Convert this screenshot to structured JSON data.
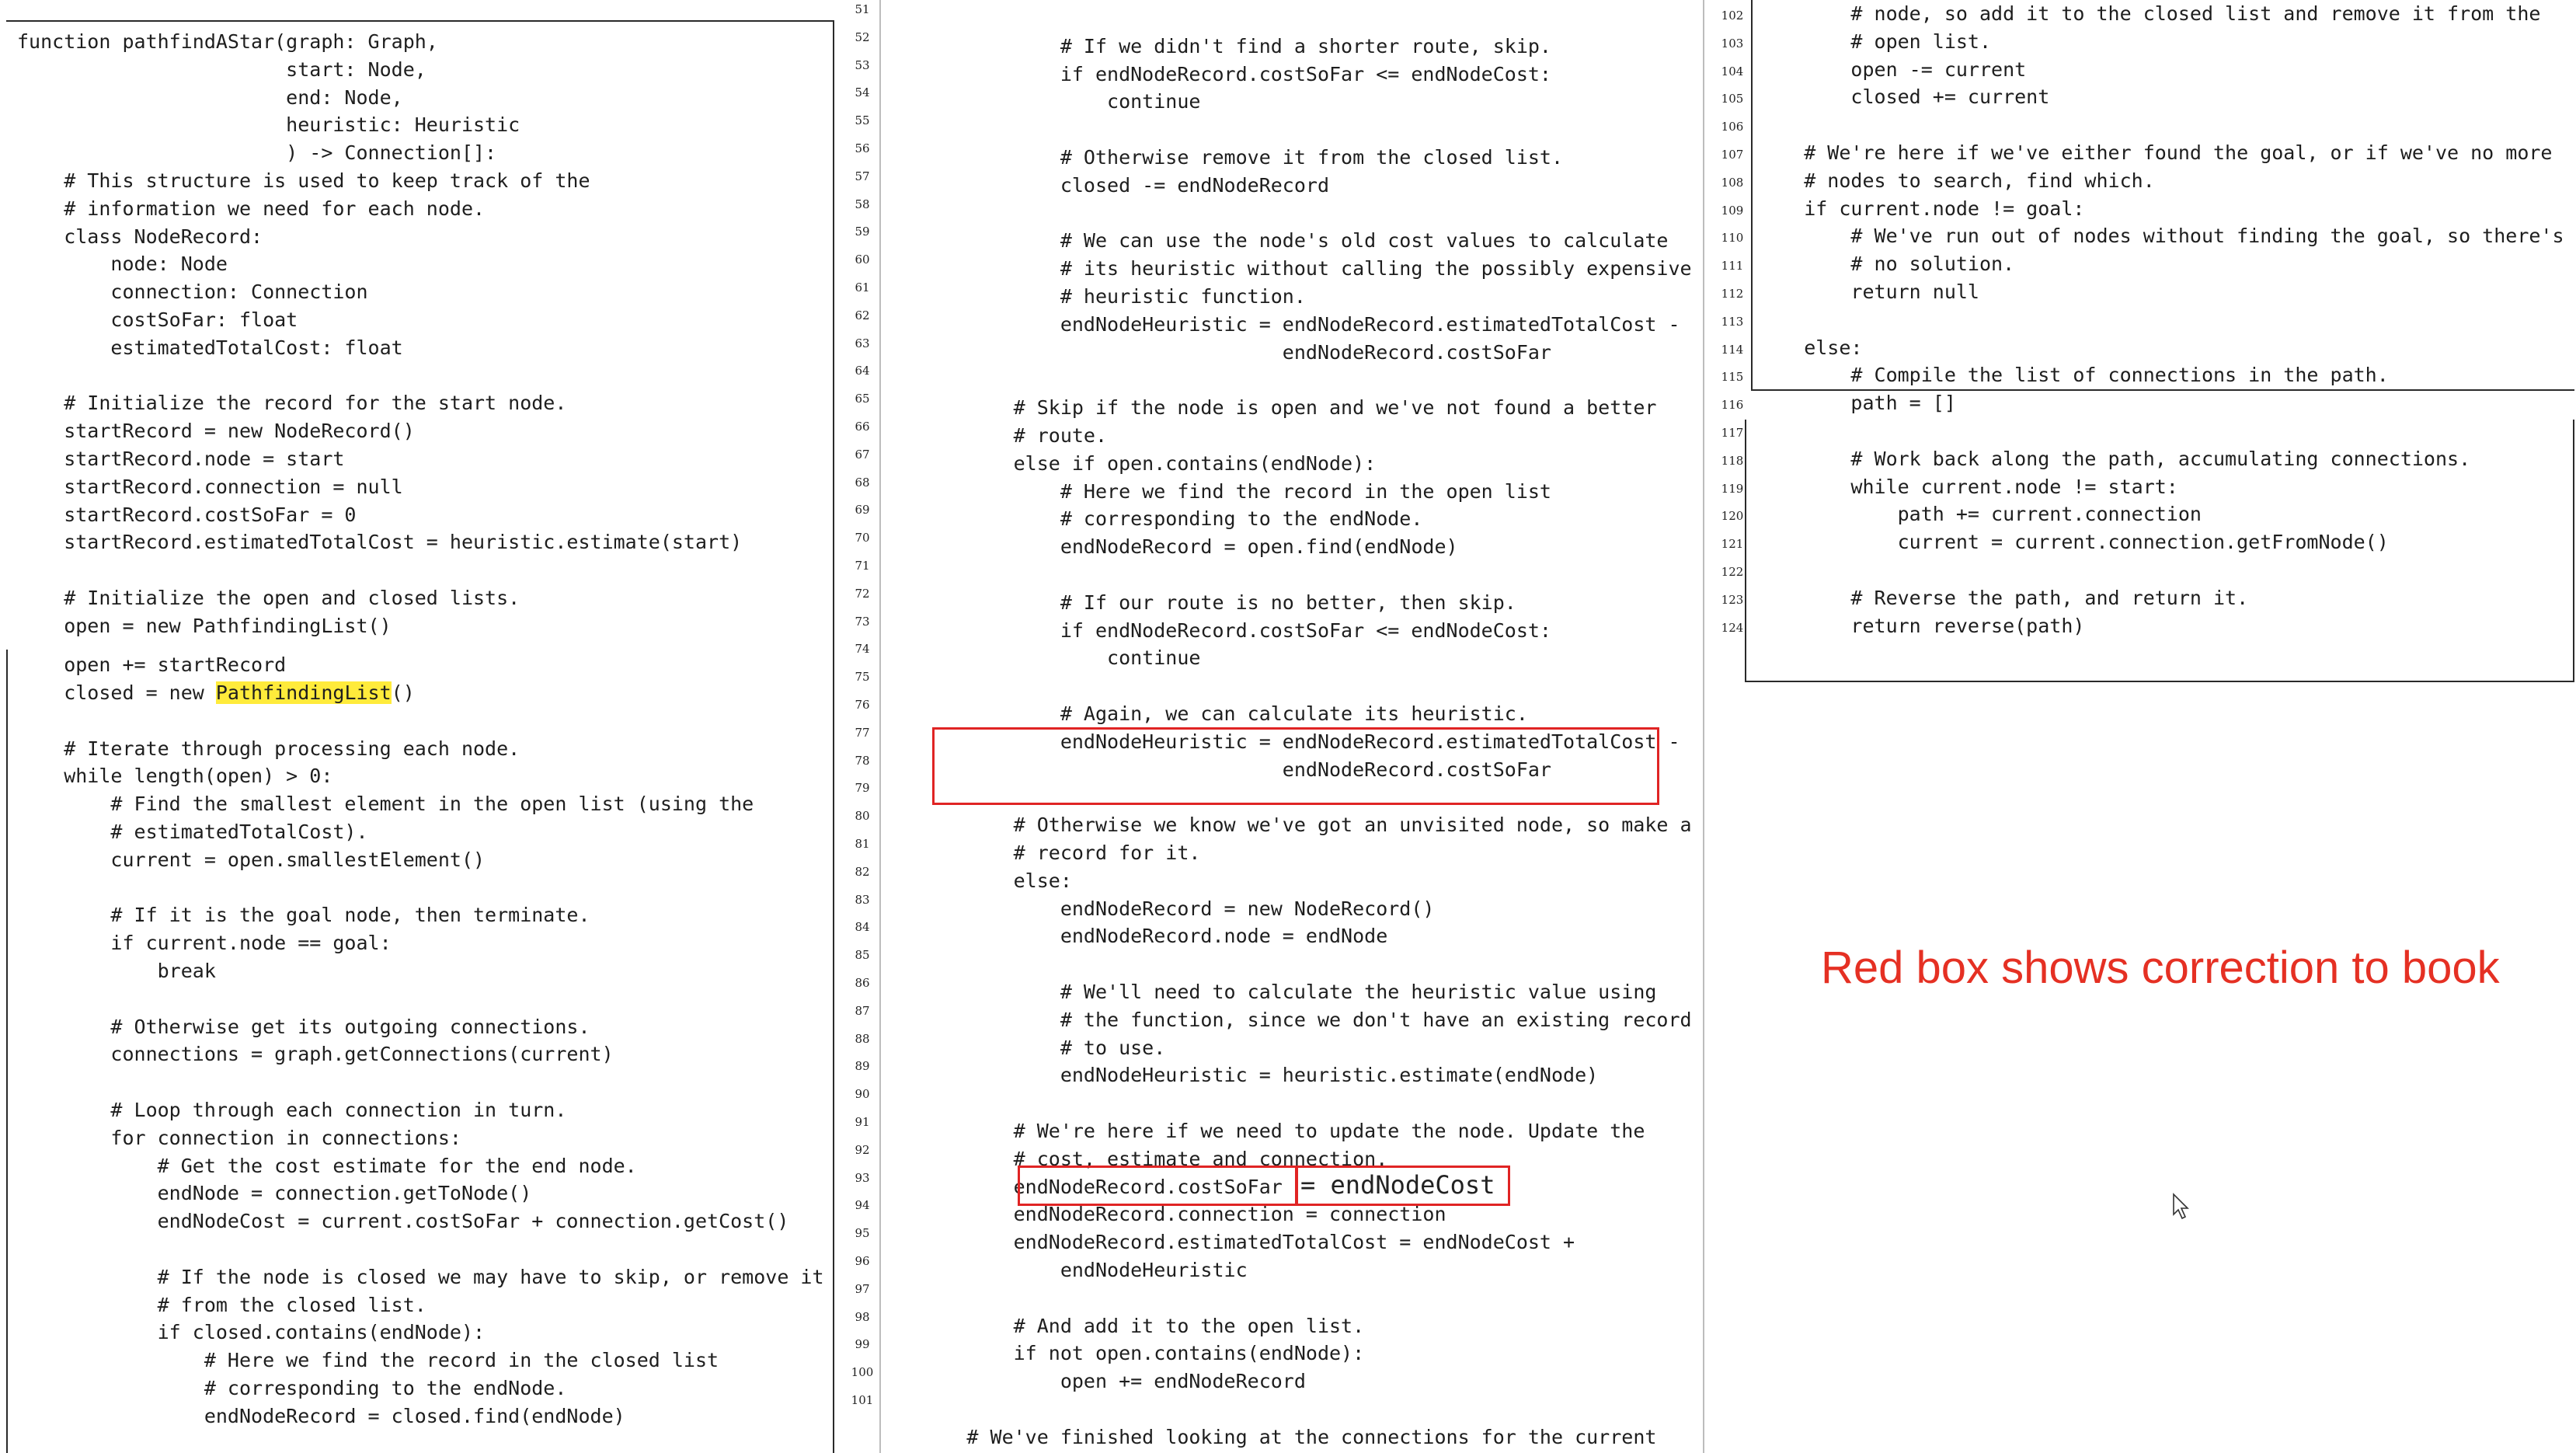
{
  "left": {
    "lines": [
      "function pathfindAStar(graph: Graph,",
      "                       start: Node,",
      "                       end: Node,",
      "                       heuristic: Heuristic",
      "                       ) -> Connection[]:",
      "    # This structure is used to keep track of the",
      "    # information we need for each node.",
      "    class NodeRecord:",
      "        node: Node",
      "        connection: Connection",
      "        costSoFar: float",
      "        estimatedTotalCost: float",
      "",
      "    # Initialize the record for the start node.",
      "    startRecord = new NodeRecord()",
      "    startRecord.node = start",
      "    startRecord.connection = null",
      "    startRecord.costSoFar = 0",
      "    startRecord.estimatedTotalCost = heuristic.estimate(start)",
      "",
      "    # Initialize the open and closed lists.",
      "    open = new PathfindingList()"
    ],
    "lines2_pre": "    closed = new ",
    "lines2_hl": "PathfindingList",
    "lines2_post": "()",
    "line_open": "    open += startRecord",
    "lines3": [
      "",
      "    # Iterate through processing each node.",
      "    while length(open) > 0:",
      "        # Find the smallest element in the open list (using the",
      "        # estimatedTotalCost).",
      "        current = open.smallestElement()",
      "",
      "        # If it is the goal node, then terminate.",
      "        if current.node == goal:",
      "            break",
      "",
      "        # Otherwise get its outgoing connections.",
      "        connections = graph.getConnections(current)",
      "",
      "        # Loop through each connection in turn.",
      "        for connection in connections:",
      "            # Get the cost estimate for the end node.",
      "            endNode = connection.getToNode()",
      "            endNodeCost = current.costSoFar + connection.getCost()",
      "",
      "            # If the node is closed we may have to skip, or remove it",
      "            # from the closed list.",
      "            if closed.contains(endNode):",
      "                # Here we find the record in the closed list",
      "                # corresponding to the endNode.",
      "                endNodeRecord = closed.find(endNode)"
    ]
  },
  "middle": {
    "numbers": [
      "51",
      "52",
      "53",
      "54",
      "55",
      "56",
      "57",
      "58",
      "59",
      "60",
      "61",
      "62",
      "63",
      "64",
      "65",
      "66",
      "67",
      "68",
      "69",
      "70",
      "71",
      "72",
      "73",
      "74",
      "75",
      "76",
      "77",
      "78",
      "79",
      "80",
      "81",
      "82",
      "83",
      "84",
      "85",
      "86",
      "87",
      "88",
      "89",
      "90",
      "91",
      "92",
      "93",
      "94",
      "95",
      "96",
      "97",
      "98",
      "99",
      "100",
      "101"
    ],
    "lines": [
      "",
      "                # If we didn't find a shorter route, skip.",
      "                if endNodeRecord.costSoFar <= endNodeCost:",
      "                    continue",
      "",
      "                # Otherwise remove it from the closed list.",
      "                closed -= endNodeRecord",
      "",
      "                # We can use the node's old cost values to calculate",
      "                # its heuristic without calling the possibly expensive",
      "                # heuristic function.",
      "                endNodeHeuristic = endNodeRecord.estimatedTotalCost -",
      "                                   endNodeRecord.costSoFar",
      "",
      "            # Skip if the node is open and we've not found a better",
      "            # route.",
      "            else if open.contains(endNode):",
      "                # Here we find the record in the open list",
      "                # corresponding to the endNode.",
      "                endNodeRecord = open.find(endNode)",
      "",
      "                # If our route is no better, then skip.",
      "                if endNodeRecord.costSoFar <= endNodeCost:",
      "                    continue",
      "",
      "                # Again, we can calculate its heuristic.",
      "                endNodeHeuristic = endNodeRecord.estimatedTotalCost -",
      "                                   endNodeRecord.costSoFar",
      "",
      "            # Otherwise we know we've got an unvisited node, so make a",
      "            # record for it.",
      "            else:",
      "                endNodeRecord = new NodeRecord()",
      "                endNodeRecord.node = endNode",
      "",
      "                # We'll need to calculate the heuristic value using",
      "                # the function, since we don't have an existing record",
      "                # to use.",
      "                endNodeHeuristic = heuristic.estimate(endNode)",
      "",
      "            # We're here if we need to update the node. Update the",
      "            # cost, estimate and connection.",
      "            endNodeRecord.costSoFar",
      "            endNodeRecord.connection = connection",
      "            endNodeRecord.estimatedTotalCost = endNodeCost +",
      "                endNodeHeuristic",
      "",
      "            # And add it to the open list.",
      "            if not open.contains(endNode):",
      "                open += endNodeRecord",
      "",
      "        # We've finished looking at the connections for the current"
    ],
    "correction_text": "= endNodeCost"
  },
  "right": {
    "numbers": [
      "102",
      "103",
      "104",
      "105",
      "106",
      "107",
      "108",
      "109",
      "110",
      "111",
      "112",
      "113",
      "114",
      "115",
      "116",
      "117",
      "118",
      "119",
      "120",
      "121",
      "122",
      "123",
      "124"
    ],
    "lines": [
      "        # node, so add it to the closed list and remove it from the",
      "        # open list.",
      "        open -= current",
      "        closed += current",
      "",
      "    # We're here if we've either found the goal, or if we've no more",
      "    # nodes to search, find which.",
      "    if current.node != goal:",
      "        # We've run out of nodes without finding the goal, so there's",
      "        # no solution.",
      "        return null",
      "",
      "    else:",
      "        # Compile the list of connections in the path.",
      "        path = []",
      "",
      "        # Work back along the path, accumulating connections.",
      "        while current.node != start:",
      "            path += current.connection",
      "            current = current.connection.getFromNode()",
      "",
      "        # Reverse the path, and return it.",
      "        return reverse(path)"
    ]
  },
  "annotation": {
    "text": "Red box shows correction to book",
    "color": "#e53023"
  },
  "highlight_color": "#ffeb3b",
  "box_color": "#e02424"
}
